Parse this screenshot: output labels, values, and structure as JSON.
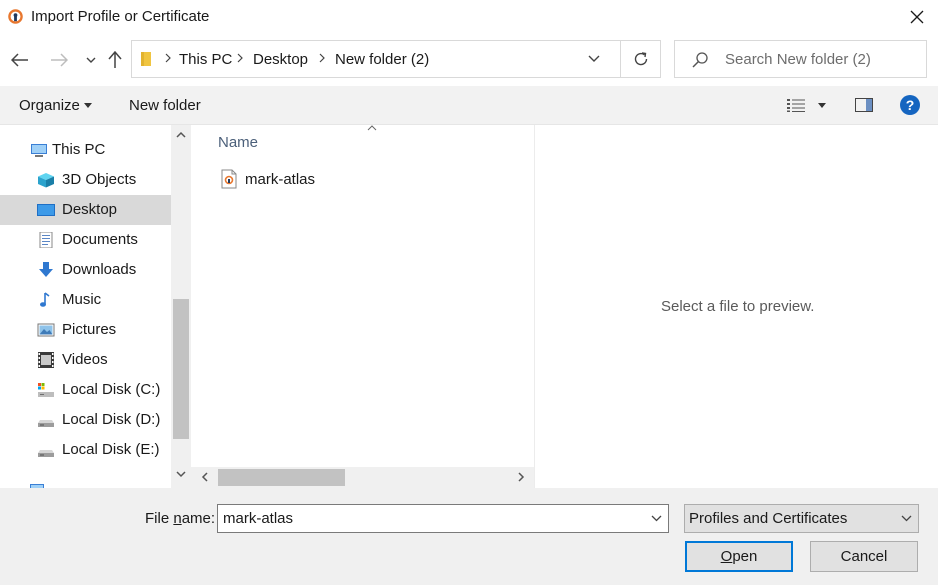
{
  "window": {
    "title": "Import Profile or Certificate",
    "accent": "#0078d7"
  },
  "nav": {
    "back_icon": "arrow-left-icon",
    "forward_icon": "arrow-right-icon",
    "recent_icon": "chevron-down-icon",
    "up_icon": "arrow-up-icon",
    "breadcrumbs": [
      "This PC",
      "Desktop",
      "New folder (2)"
    ],
    "search_placeholder": "Search New folder (2)"
  },
  "toolbar": {
    "organize_label": "Organize",
    "new_folder_label": "New folder"
  },
  "sidebar": {
    "items": [
      {
        "label": "This PC",
        "icon": "pc-icon"
      },
      {
        "label": "3D Objects",
        "icon": "cube-icon"
      },
      {
        "label": "Desktop",
        "icon": "desktop-icon",
        "selected": true
      },
      {
        "label": "Documents",
        "icon": "documents-icon"
      },
      {
        "label": "Downloads",
        "icon": "download-icon"
      },
      {
        "label": "Music",
        "icon": "music-icon"
      },
      {
        "label": "Pictures",
        "icon": "pictures-icon"
      },
      {
        "label": "Videos",
        "icon": "videos-icon"
      },
      {
        "label": "Local Disk (C:)",
        "icon": "drive-icon"
      },
      {
        "label": "Local Disk (D:)",
        "icon": "drive-icon"
      },
      {
        "label": "Local Disk (E:)",
        "icon": "drive-icon"
      }
    ]
  },
  "files": {
    "column_name": "Name",
    "items": [
      {
        "name": "mark-atlas",
        "icon": "profile-file-icon"
      }
    ]
  },
  "preview": {
    "message": "Select a file to preview."
  },
  "footer": {
    "file_name_label_pre": "File ",
    "file_name_label_underlined": "n",
    "file_name_label_post": "ame:",
    "file_name_value": "mark-atlas",
    "file_type_value": "Profiles and Certificates",
    "open_label_underlined": "O",
    "open_label_rest": "pen",
    "cancel_label": "Cancel"
  }
}
